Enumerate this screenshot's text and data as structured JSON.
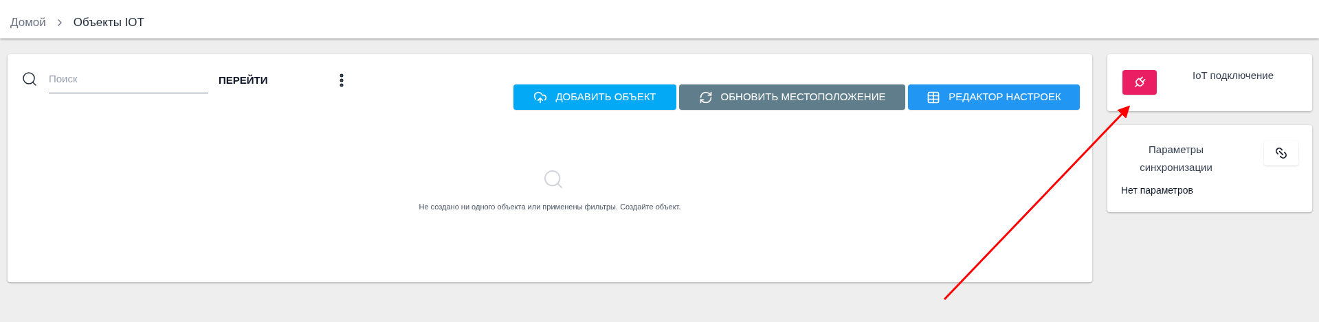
{
  "breadcrumbs": [
    "Домой",
    "Объекты IOT"
  ],
  "search": {
    "placeholder": "Поиск",
    "go_label": "ПЕРЕЙТИ"
  },
  "toolbar": [
    {
      "kind": "add",
      "label": "ДОБАВИТЬ ОБЪЕКТ"
    },
    {
      "kind": "refresh",
      "label": "ОБНОВИТЬ МЕСТОПОЛОЖЕНИЕ"
    },
    {
      "kind": "editor",
      "label": "РЕДАКТОР НАСТРОЕК"
    }
  ],
  "empty_state": {
    "message": "Не создано ни одного объекта или применены фильтры. Создайте объект."
  },
  "iot_card": {
    "title": "IoT подключение"
  },
  "sync_card": {
    "title": "Параметры синхронизации",
    "empty_text": "Нет параметров"
  }
}
